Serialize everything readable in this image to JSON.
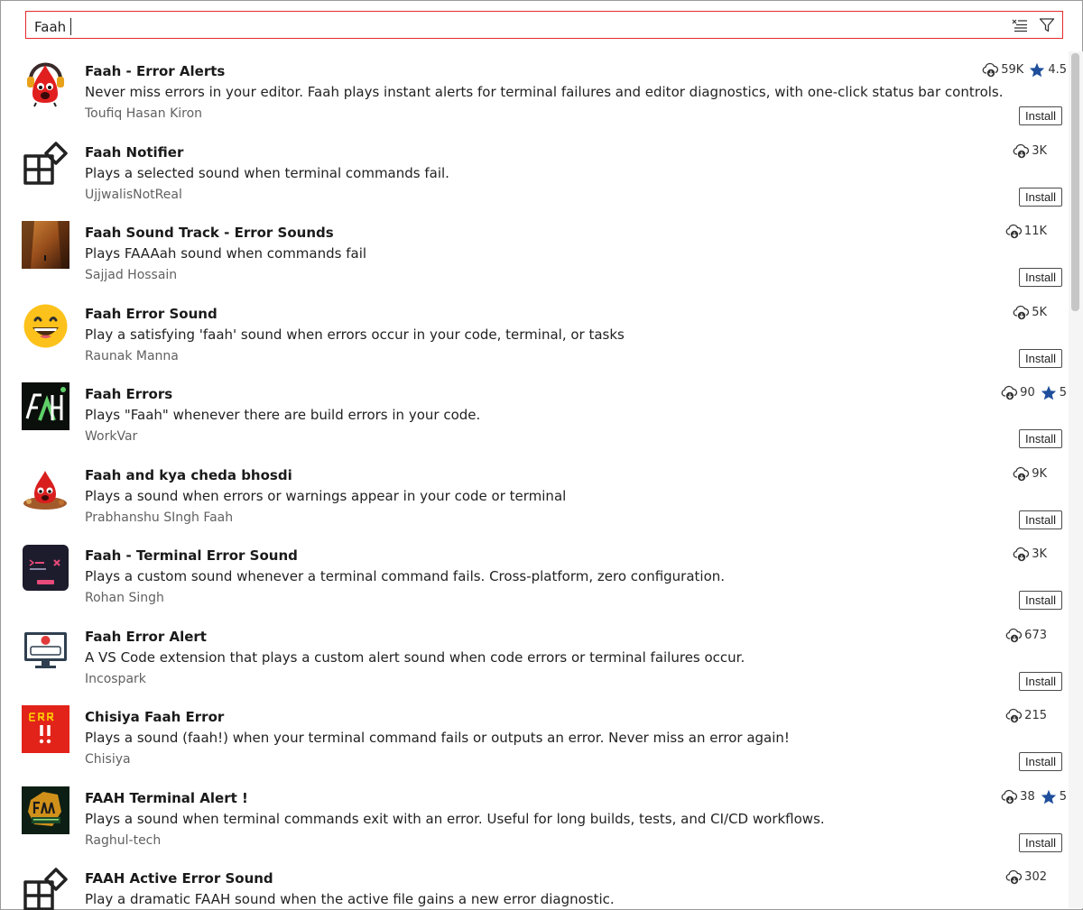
{
  "search": {
    "value": "Faah"
  },
  "icons": {
    "clear": "clear-filter-icon",
    "filter": "filter-icon",
    "download": "cloud-download-icon",
    "star": "star-icon"
  },
  "colors": {
    "search_border": "#e5292c",
    "star": "#1f4e9c"
  },
  "extensions": [
    {
      "name": "Faah - Error Alerts",
      "description": "Never miss errors in your editor. Faah plays instant alerts for terminal failures and editor diagnostics, with one-click status bar controls.",
      "publisher": "Toufiq Hasan Kiron",
      "downloads": "59K",
      "rating": "4.5",
      "install": "Install",
      "icon": "red-mascot-headphones-icon"
    },
    {
      "name": "Faah Notifier",
      "description": "Plays a selected sound when terminal commands fail.",
      "publisher": "UjjwalisNotReal",
      "downloads": "3K",
      "install": "Install",
      "icon": "default-extension-icon"
    },
    {
      "name": "Faah Sound Track - Error Sounds",
      "description": "Plays FAAAah sound when commands fail",
      "publisher": "Sajjad Hossain",
      "downloads": "11K",
      "install": "Install",
      "icon": "sunset-canyon-icon"
    },
    {
      "name": "Faah Error Sound",
      "description": "Play a satisfying 'faah' sound when errors occur in your code, terminal, or tasks",
      "publisher": "Raunak Manna",
      "downloads": "5K",
      "install": "Install",
      "icon": "grinning-face-icon"
    },
    {
      "name": "Faah Errors",
      "description": "Plays \"Faah\" whenever there are build errors in your code.",
      "publisher": "WorkVar",
      "downloads": "90",
      "rating": "5",
      "install": "Install",
      "icon": "faah-logo-icon"
    },
    {
      "name": "Faah and kya cheda bhosdi",
      "description": "Plays a sound when errors or warnings appear in your code or terminal",
      "publisher": "Prabhanshu SIngh Faah",
      "downloads": "9K",
      "install": "Install",
      "icon": "red-mascot-icon"
    },
    {
      "name": "Faah - Terminal Error Sound",
      "description": "Plays a custom sound whenever a terminal command fails. Cross-platform, zero configuration.",
      "publisher": "Rohan Singh",
      "downloads": "3K",
      "install": "Install",
      "icon": "terminal-icon"
    },
    {
      "name": "Faah Error Alert",
      "description": "A VS Code extension that plays a custom alert sound when code errors or terminal failures occur.",
      "publisher": "Incospark",
      "downloads": "673",
      "install": "Install",
      "icon": "error-monitor-icon"
    },
    {
      "name": "Chisiya Faah Error",
      "description": "Plays a sound (faah!) when your terminal command fails or outputs an error. Never miss an error again!",
      "publisher": "Chisiya",
      "downloads": "215",
      "install": "Install",
      "icon": "err-badge-icon"
    },
    {
      "name": "FAAH Terminal Alert !",
      "description": "Plays a sound when terminal commands exit with an error. Useful for long builds, tests, and CI/CD workflows.",
      "publisher": "Raghul-tech",
      "downloads": "38",
      "rating": "5",
      "install": "Install",
      "icon": "faah-terminal-alert-icon"
    },
    {
      "name": "FAAH Active Error Sound",
      "description": "Play a dramatic FAAH sound when the active file gains a new error diagnostic.",
      "publisher": "",
      "downloads": "302",
      "icon": "default-extension-icon"
    }
  ]
}
